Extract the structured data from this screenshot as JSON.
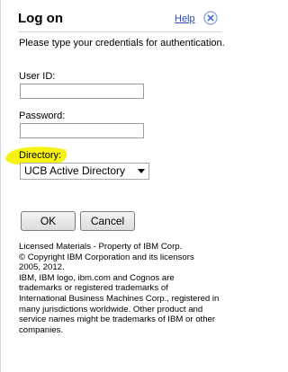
{
  "dialog": {
    "title": "Log on",
    "help_label": "Help",
    "close_icon": "close-icon",
    "instructions": "Please type your credentials for authentication."
  },
  "form": {
    "user_id_label": "User ID:",
    "user_id_value": "",
    "password_label": "Password:",
    "password_value": "",
    "directory_label": "Directory:",
    "directory_selected": "UCB Active Directory"
  },
  "buttons": {
    "ok_label": "OK",
    "cancel_label": "Cancel"
  },
  "legal": {
    "lines": [
      "Licensed Materials - Property of IBM Corp.",
      "© Copyright IBM Corporation and its licensors",
      "2005, 2012.",
      "IBM, IBM logo, ibm.com and Cognos are",
      "trademarks or registered trademarks of",
      "International Business Machines Corp., registered in",
      "many jurisdictions worldwide. Other product and",
      "service names might be trademarks of IBM or other",
      "companies."
    ]
  },
  "colors": {
    "link": "#2b4ab8",
    "highlight": "#f5f200",
    "close_icon": "#3d6fd0"
  }
}
